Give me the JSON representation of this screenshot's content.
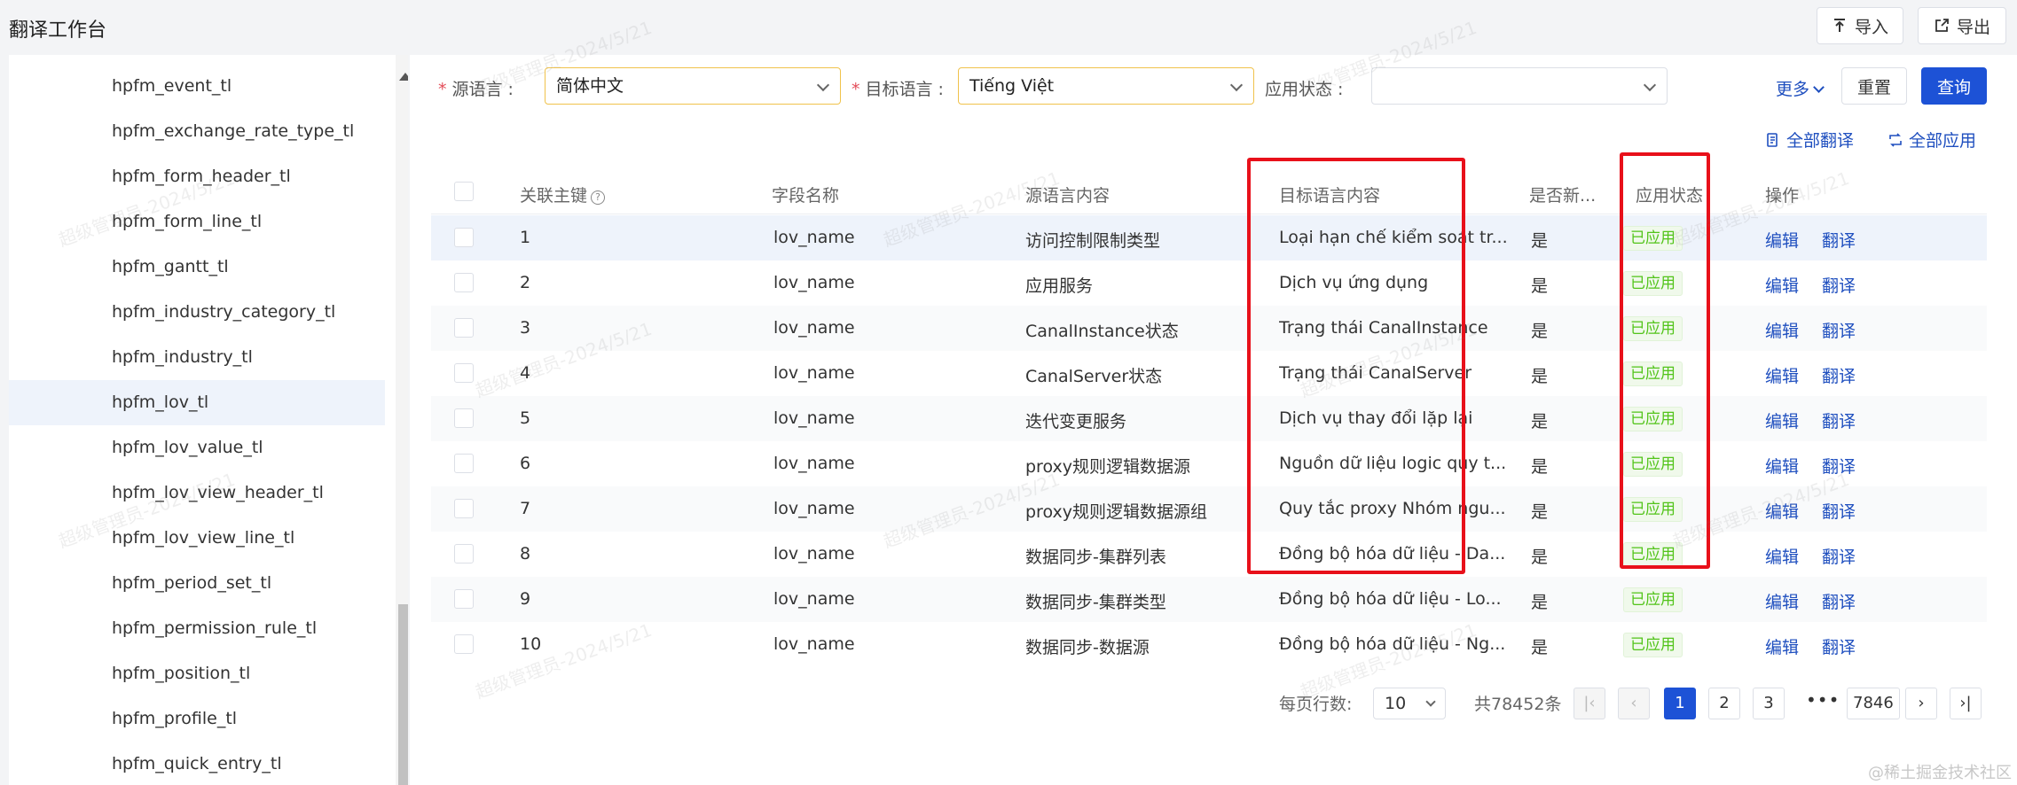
{
  "app": {
    "title": "翻译工作台"
  },
  "topbar": {
    "import_label": "导入",
    "export_label": "导出"
  },
  "sidebar": {
    "items": [
      {
        "label": "hpfm_event_tl"
      },
      {
        "label": "hpfm_exchange_rate_type_tl"
      },
      {
        "label": "hpfm_form_header_tl"
      },
      {
        "label": "hpfm_form_line_tl"
      },
      {
        "label": "hpfm_gantt_tl"
      },
      {
        "label": "hpfm_industry_category_tl"
      },
      {
        "label": "hpfm_industry_tl"
      },
      {
        "label": "hpfm_lov_tl",
        "selected": true
      },
      {
        "label": "hpfm_lov_value_tl"
      },
      {
        "label": "hpfm_lov_view_header_tl"
      },
      {
        "label": "hpfm_lov_view_line_tl"
      },
      {
        "label": "hpfm_period_set_tl"
      },
      {
        "label": "hpfm_permission_rule_tl"
      },
      {
        "label": "hpfm_position_tl"
      },
      {
        "label": "hpfm_profile_tl"
      },
      {
        "label": "hpfm_quick_entry_tl"
      }
    ]
  },
  "filters": {
    "required_mark": "*",
    "source_label": "源语言 :",
    "source_value": "简体中文",
    "target_label": "目标语言 :",
    "target_value": "Tiếng Việt",
    "status_label": "应用状态 :",
    "status_value": "",
    "more_label": "更多",
    "reset_label": "重置",
    "query_label": "查询"
  },
  "actions": {
    "translate_all": "全部翻译",
    "apply_all": "全部应用"
  },
  "table": {
    "headers": {
      "key": "关联主键",
      "field": "字段名称",
      "source": "源语言内容",
      "target": "目标语言内容",
      "is_new": "是否新...",
      "status": "应用状态",
      "ops": "操作"
    },
    "edit_label": "编辑",
    "translate_label": "翻译",
    "rows": [
      {
        "key": "1",
        "field": "lov_name",
        "source": "访问控制限制类型",
        "target": "Loại hạn chế kiểm soát tr...",
        "is_new": "是",
        "status": "已应用"
      },
      {
        "key": "2",
        "field": "lov_name",
        "source": "应用服务",
        "target": "Dịch vụ ứng dụng",
        "is_new": "是",
        "status": "已应用"
      },
      {
        "key": "3",
        "field": "lov_name",
        "source": "CanalInstance状态",
        "target": "Trạng thái CanalInstance",
        "is_new": "是",
        "status": "已应用"
      },
      {
        "key": "4",
        "field": "lov_name",
        "source": "CanalServer状态",
        "target": "Trạng thái CanalServer",
        "is_new": "是",
        "status": "已应用"
      },
      {
        "key": "5",
        "field": "lov_name",
        "source": "迭代变更服务",
        "target": "Dịch vụ thay đổi lặp lại",
        "is_new": "是",
        "status": "已应用"
      },
      {
        "key": "6",
        "field": "lov_name",
        "source": "proxy规则逻辑数据源",
        "target": "Nguồn dữ liệu logic quy t...",
        "is_new": "是",
        "status": "已应用"
      },
      {
        "key": "7",
        "field": "lov_name",
        "source": "proxy规则逻辑数据源组",
        "target": "Quy tắc proxy Nhóm ngu...",
        "is_new": "是",
        "status": "已应用"
      },
      {
        "key": "8",
        "field": "lov_name",
        "source": "数据同步-集群列表",
        "target": "Đồng bộ hóa dữ liệu - Da...",
        "is_new": "是",
        "status": "已应用"
      },
      {
        "key": "9",
        "field": "lov_name",
        "source": "数据同步-集群类型",
        "target": "Đồng bộ hóa dữ liệu - Lo...",
        "is_new": "是",
        "status": "已应用"
      },
      {
        "key": "10",
        "field": "lov_name",
        "source": "数据同步-数据源",
        "target": "Đồng bộ hóa dữ liệu - Ng...",
        "is_new": "是",
        "status": "已应用"
      }
    ]
  },
  "pagination": {
    "rows_per_page_label": "每页行数:",
    "page_size": "10",
    "total_label": "共78452条",
    "pages": [
      "1",
      "2",
      "3"
    ],
    "ellipsis": "•••",
    "last_page": "7846"
  },
  "watermark": {
    "text": "超级管理员-2024/5/21",
    "corner_text": "@稀土掘金技术社区"
  },
  "colors": {
    "primary": "#1d52d6",
    "link": "#1f4fbf",
    "success": "#52c41a",
    "highlight_box": "#e8101a",
    "required": "#e34d59"
  }
}
